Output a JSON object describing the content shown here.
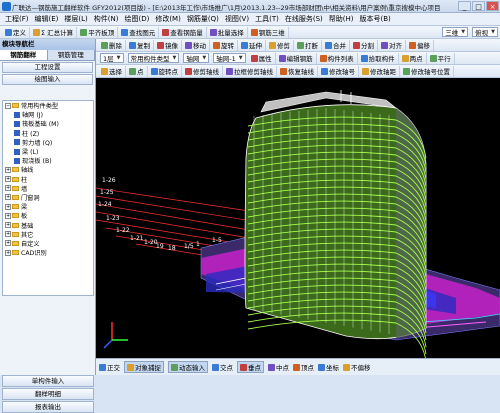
{
  "window": {
    "title": "广联达—钢筋施工翻样软件 GFY2012(项目版) - [E:\\2013年工作\\市场推广\\1月\\2013.1.23--29市场部财团\\中\\相关资料\\用户案例\\重京搜模中心项目",
    "controls": [
      "_",
      "□",
      "×"
    ]
  },
  "menu": [
    "工程(F)",
    "编辑(E)",
    "楼层(L)",
    "构件(N)",
    "绘图(D)",
    "修改(M)",
    "钢筋量(Q)",
    "视图(V)",
    "工具(T)",
    "在线服务(S)",
    "帮助(H)",
    "版本号(B)"
  ],
  "toolbar1": [
    "定义",
    "Σ 汇总计算",
    "平齐板顶",
    "查找图元",
    "查看钢筋量",
    "批量选择",
    "钢筋三维"
  ],
  "toolbar1_right": [
    "三维",
    "俯视"
  ],
  "sidebar": {
    "title": "模块导航栏",
    "tabs": [
      "钢筋翻样",
      "钢筋管理"
    ],
    "buttons_top": [
      "工程设置",
      "绘图输入"
    ],
    "tree": [
      {
        "label": "常用构件类型",
        "level": 0,
        "type": "folder",
        "expanded": true
      },
      {
        "label": "轴网 (J)",
        "level": 1,
        "type": "leaf",
        "color": "#3060c0"
      },
      {
        "label": "筏板基础 (M)",
        "level": 1,
        "type": "leaf",
        "color": "#3060c0"
      },
      {
        "label": "柱 (Z)",
        "level": 1,
        "type": "leaf",
        "color": "#3060c0"
      },
      {
        "label": "剪力墙 (Q)",
        "level": 1,
        "type": "leaf",
        "color": "#3060c0"
      },
      {
        "label": "梁 (L)",
        "level": 1,
        "type": "leaf",
        "color": "#3060c0"
      },
      {
        "label": "现浇板 (B)",
        "level": 1,
        "type": "leaf",
        "color": "#3060c0"
      },
      {
        "label": "轴线",
        "level": 0,
        "type": "folder",
        "expanded": false
      },
      {
        "label": "柱",
        "level": 0,
        "type": "folder",
        "expanded": false
      },
      {
        "label": "墙",
        "level": 0,
        "type": "folder",
        "expanded": false
      },
      {
        "label": "门窗洞",
        "level": 0,
        "type": "folder",
        "expanded": false
      },
      {
        "label": "梁",
        "level": 0,
        "type": "folder",
        "expanded": false
      },
      {
        "label": "板",
        "level": 0,
        "type": "folder",
        "expanded": false
      },
      {
        "label": "基础",
        "level": 0,
        "type": "folder",
        "expanded": false
      },
      {
        "label": "其它",
        "level": 0,
        "type": "folder",
        "expanded": false
      },
      {
        "label": "自定义",
        "level": 0,
        "type": "folder",
        "expanded": false
      },
      {
        "label": "CAD识别",
        "level": 0,
        "type": "folder",
        "expanded": false
      }
    ],
    "buttons_bottom": [
      "单构件输入",
      "翻样明细",
      "报表输出"
    ]
  },
  "toolbar2": [
    "删除",
    "复制",
    "镜像",
    "移动",
    "旋转",
    "延伸",
    "修剪",
    "打断",
    "合并",
    "分割",
    "对齐",
    "偏移"
  ],
  "toolbar3": {
    "floor": "1层",
    "category": "常用构件类型",
    "type": "轴网",
    "name": "轴网-1",
    "buttons": [
      "属性",
      "编辑钢筋",
      "构件列表",
      "拾取构件",
      "两点",
      "平行"
    ]
  },
  "toolbar4": [
    "选择",
    "点",
    "旋转点",
    "修剪轴线",
    "拉框修剪轴线",
    "恢复轴线",
    "修改轴号",
    "修改轴距",
    "修改轴号位置"
  ],
  "viewport": {
    "axis_labels": [
      "1-26",
      "1-25",
      "1-24",
      "1-23",
      "1-22",
      "1-21",
      "1-20",
      "19",
      "18",
      "1/5",
      "1",
      "1-5"
    ]
  },
  "statusbar": [
    "正交",
    "对象捕捉",
    "动态输入",
    "交点",
    "垂点",
    "中点",
    "顶点",
    "坐标",
    "不偏移"
  ],
  "colors": {
    "building_green": "#a8ff4a",
    "building_white": "#ffffff",
    "podium_magenta": "#ff20ff",
    "podium_blue": "#4040ff",
    "axis_red": "#ff3030",
    "bg": "#000000"
  }
}
